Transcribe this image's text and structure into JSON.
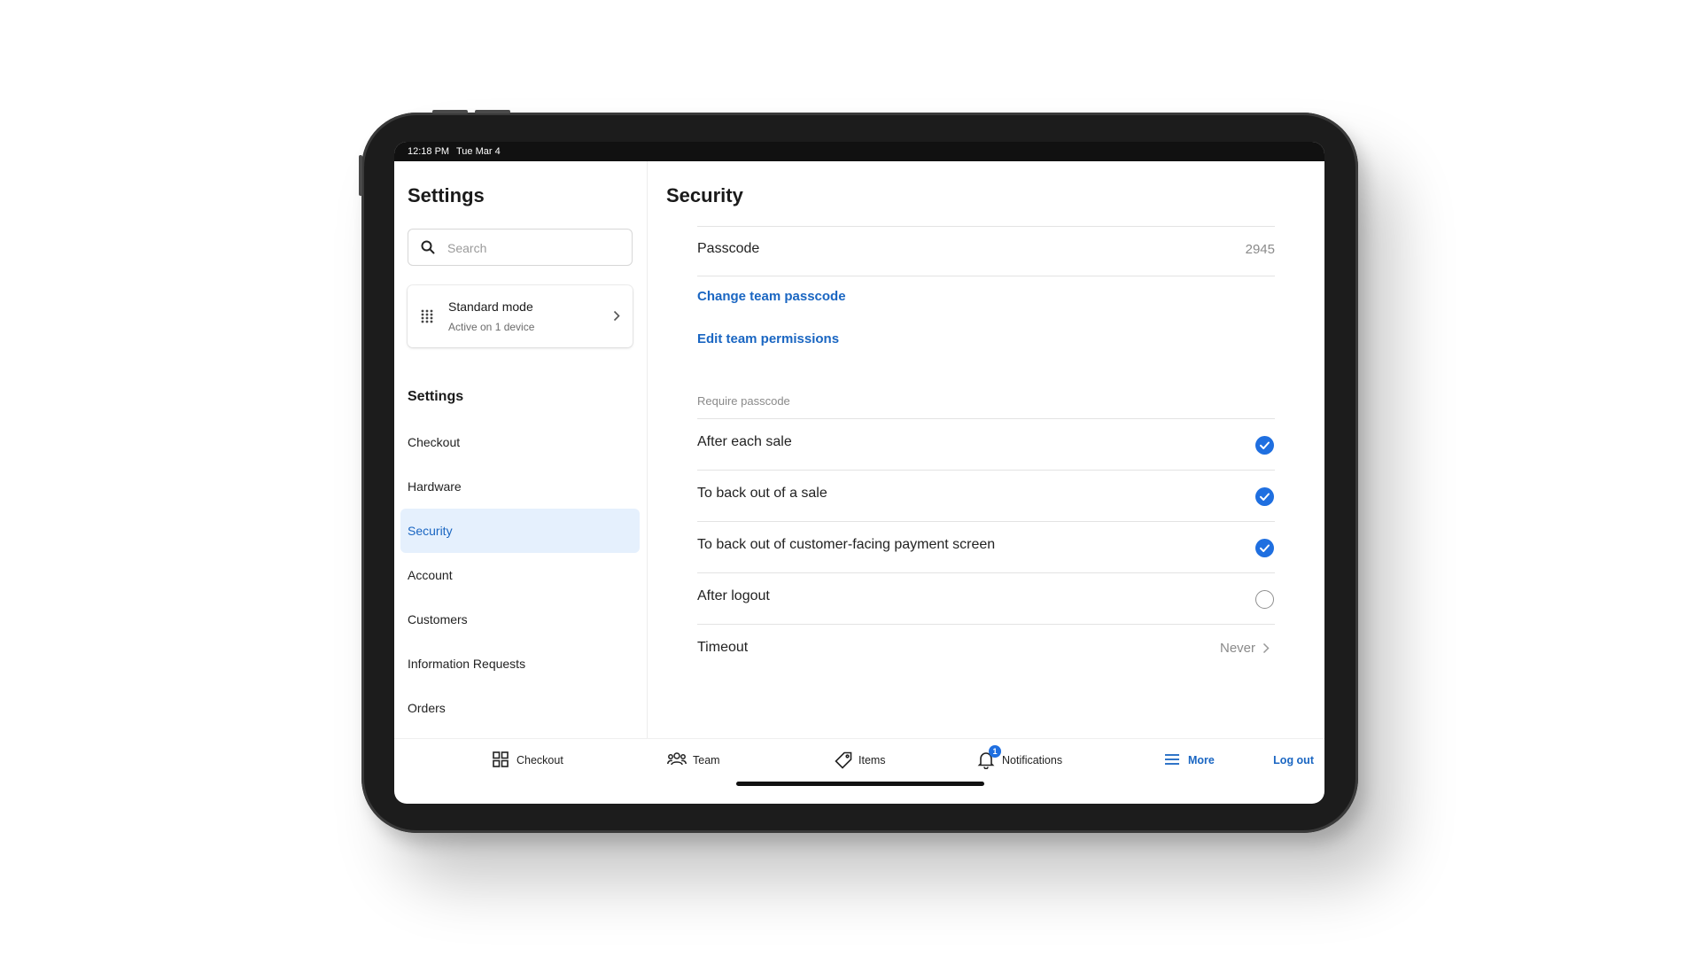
{
  "status_bar": {
    "time": "12:18 PM",
    "date": "Tue Mar 4"
  },
  "sidebar": {
    "title": "Settings",
    "search": {
      "placeholder": "Search",
      "value": ""
    },
    "mode_card": {
      "title": "Standard mode",
      "subtitle": "Active on 1 device"
    },
    "section_title": "Settings",
    "items": [
      {
        "label": "Checkout",
        "active": false
      },
      {
        "label": "Hardware",
        "active": false
      },
      {
        "label": "Security",
        "active": true
      },
      {
        "label": "Account",
        "active": false
      },
      {
        "label": "Customers",
        "active": false
      },
      {
        "label": "Information Requests",
        "active": false
      },
      {
        "label": "Orders",
        "active": false
      }
    ]
  },
  "main": {
    "title": "Security",
    "passcode": {
      "label": "Passcode",
      "value": "2945"
    },
    "links": {
      "change_passcode": "Change team passcode",
      "edit_permissions": "Edit team permissions"
    },
    "require_label": "Require passcode",
    "options": [
      {
        "label": "After each sale",
        "checked": true
      },
      {
        "label": "To back out of a sale",
        "checked": true
      },
      {
        "label": "To back out of customer-facing payment screen",
        "checked": true
      },
      {
        "label": "After logout",
        "checked": false
      }
    ],
    "timeout": {
      "label": "Timeout",
      "value": "Never"
    }
  },
  "bottom_nav": {
    "items": [
      {
        "label": "Checkout",
        "icon": "grid-icon"
      },
      {
        "label": "Team",
        "icon": "team-icon"
      },
      {
        "label": "Items",
        "icon": "tag-icon"
      },
      {
        "label": "Notifications",
        "icon": "bell-icon",
        "badge": "1"
      },
      {
        "label": "More",
        "icon": "menu-icon",
        "active": true
      }
    ],
    "logout": "Log out"
  },
  "colors": {
    "accent": "#1a66c2",
    "check": "#1f6fe0",
    "active_bg": "#e5f0fd"
  }
}
